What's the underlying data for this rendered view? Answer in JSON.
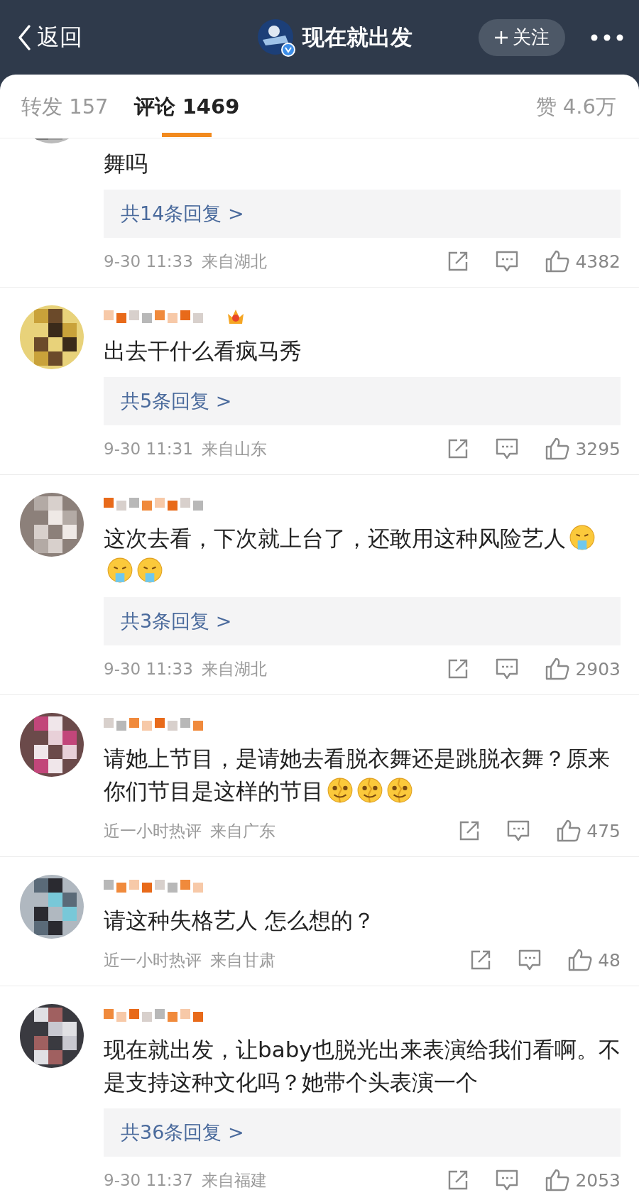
{
  "header": {
    "back_label": "返回",
    "title": "现在就出发",
    "verified": true,
    "follow_label": "关注"
  },
  "tabs": [
    {
      "label": "转发 157",
      "selected": false
    },
    {
      "label": "评论 1469",
      "selected": true
    }
  ],
  "likes_total": "赞 4.6万",
  "comments": [
    {
      "cut": true,
      "vip": false,
      "text": "舞吗",
      "replies": "共14条回复 >",
      "time": "9-30 11:33",
      "location": "来自湖北",
      "likes": "4382"
    },
    {
      "cut": false,
      "vip": true,
      "text": "出去干什么看疯马秀",
      "replies": "共5条回复 >",
      "time": "9-30 11:31",
      "location": "来自山东",
      "likes": "3295"
    },
    {
      "cut": false,
      "vip": false,
      "text": "这次去看，下次就上台了，还敢用这种风险艺人",
      "emojis": [
        {
          "kind": "vomit"
        },
        {
          "kind": "vomit"
        },
        {
          "kind": "vomit"
        }
      ],
      "replies": "共3条回复 >",
      "time": "9-30 11:33",
      "location": "来自湖北",
      "likes": "2903"
    },
    {
      "cut": false,
      "vip": false,
      "text": "请她上节目，是请她去看脱衣舞还是跳脱衣舞？原来你们节目是这样的节目",
      "emojis": [
        {
          "kind": "split"
        },
        {
          "kind": "split"
        },
        {
          "kind": "split"
        }
      ],
      "time": "近一小时热评",
      "location": "来自广东",
      "likes": "475"
    },
    {
      "cut": false,
      "vip": false,
      "text": "请这种失格艺人 怎么想的？",
      "time": "近一小时热评",
      "location": "来自甘肃",
      "likes": "48"
    },
    {
      "cut": false,
      "vip": false,
      "text": "现在就出发，让baby也脱光出来表演给我们看啊。不是支持这种文化吗？她带个头表演一个",
      "replies": "共36条回复 >",
      "time": "9-30 11:37",
      "location": "来自福建",
      "likes": "2053"
    }
  ]
}
